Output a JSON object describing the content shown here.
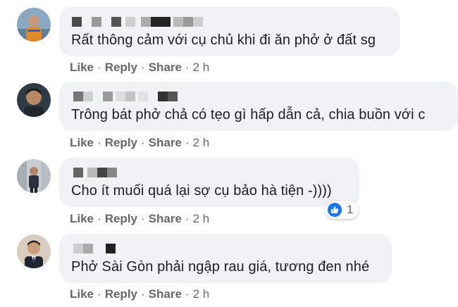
{
  "actions": {
    "like": "Like",
    "reply": "Reply",
    "share": "Share",
    "separator": "·"
  },
  "comments": [
    {
      "text": "Rất thông cảm với cụ chủ khi đi ăn phở ở đất sg",
      "time": "2 h"
    },
    {
      "text": "Trông bát phở chả có tẹo gì hấp dẫn cả, chia buồn với c",
      "time": "2 h"
    },
    {
      "text": "Cho ít muối quá lại sợ cụ bảo hà tiện -))))",
      "time": "2 h",
      "reaction_count": "1"
    },
    {
      "text": "Phở Sài Gòn phải ngập rau giá, tương đen nhé",
      "time": "2 h"
    }
  ],
  "colors": {
    "bubble": "#f0f2f5",
    "text": "#1c1e21",
    "meta": "#65676b",
    "like_blue": "#1877f2"
  },
  "icons": [
    "avatar",
    "like-reaction-icon"
  ]
}
